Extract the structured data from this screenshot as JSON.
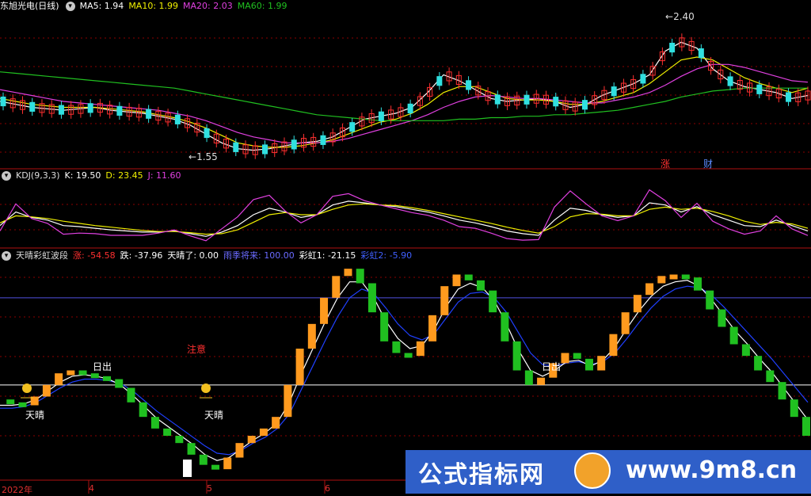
{
  "panels": {
    "price": {
      "stock_name": "东旭光电(日线)",
      "ma5_label": "MA5: 1.94",
      "ma10_label": "MA10: 1.99",
      "ma20_label": "MA20: 2.03",
      "ma60_label": "MA60: 1.99",
      "high_label": "2.40",
      "low_label": "1.55",
      "tag_zhang": "涨",
      "tag_cai": "财"
    },
    "kdj": {
      "title": "KDJ(9,3,3)",
      "k_label": "K: 19.50",
      "d_label": "D: 23.45",
      "j_label": "J: 11.60"
    },
    "rainbow": {
      "title": "天晴彩虹波段",
      "zhang_label": "涨: -54.58",
      "die_label": "跌: -37.96",
      "tianqing_label": "天晴了: 0.00",
      "yuji_label": "雨季将来: 100.00",
      "caihong1_label": "彩虹1: -21.15",
      "caihong2_label": "彩虹2: -5.90",
      "annotations": {
        "richu": "日出",
        "zhuyi": "注意",
        "tianqing": "天晴"
      }
    }
  },
  "xaxis": {
    "labels": [
      "2022年",
      "4",
      "5",
      "6"
    ]
  },
  "watermark": {
    "cn": "公式指标网",
    "url": "www.9m8.cn"
  },
  "colors": {
    "bg": "#000000",
    "grid": "#8b0000",
    "ma5": "#ffffff",
    "ma10": "#f0f000",
    "ma20": "#e040e0",
    "ma60": "#20c020",
    "up": "#ff3030",
    "down": "#30e0e0",
    "bar_up": "#ff9a1e",
    "bar_down": "#20c020",
    "k": "#ffffff",
    "d": "#f0f000",
    "j": "#e040e0",
    "rainbow1": "#ffffff",
    "rainbow2": "#2040ff"
  },
  "chart_data": [
    {
      "type": "candlestick",
      "title": "东旭光电(日线)",
      "series": [
        {
          "name": "MA5",
          "values": [
            1.9,
            1.88,
            1.86,
            1.85,
            1.84,
            1.85,
            1.86,
            1.84,
            1.83,
            1.82,
            1.8,
            1.78,
            1.74,
            1.68,
            1.62,
            1.58,
            1.57,
            1.58,
            1.6,
            1.62,
            1.63,
            1.66,
            1.72,
            1.78,
            1.8,
            1.82,
            1.86,
            1.96,
            2.08,
            2.04,
            1.98,
            1.92,
            1.9,
            1.91,
            1.92,
            1.9,
            1.86,
            1.88,
            1.94,
            1.98,
            2.02,
            2.08,
            2.24,
            2.3,
            2.26,
            2.12,
            2.04,
            2.0,
            1.98,
            1.96,
            1.92,
            1.94
          ]
        },
        {
          "name": "MA10",
          "values": [
            1.92,
            1.9,
            1.88,
            1.87,
            1.86,
            1.86,
            1.86,
            1.85,
            1.84,
            1.83,
            1.81,
            1.79,
            1.76,
            1.72,
            1.67,
            1.62,
            1.6,
            1.59,
            1.59,
            1.6,
            1.62,
            1.64,
            1.68,
            1.72,
            1.76,
            1.78,
            1.82,
            1.88,
            1.96,
            2.0,
            2.0,
            1.96,
            1.92,
            1.91,
            1.91,
            1.9,
            1.88,
            1.88,
            1.9,
            1.93,
            1.96,
            2.02,
            2.1,
            2.18,
            2.2,
            2.18,
            2.12,
            2.06,
            2.02,
            1.99,
            1.96,
            1.99
          ]
        },
        {
          "name": "MA20",
          "values": [
            1.98,
            1.96,
            1.94,
            1.92,
            1.9,
            1.89,
            1.88,
            1.87,
            1.86,
            1.85,
            1.84,
            1.82,
            1.8,
            1.77,
            1.73,
            1.69,
            1.66,
            1.64,
            1.62,
            1.62,
            1.62,
            1.63,
            1.65,
            1.68,
            1.71,
            1.74,
            1.77,
            1.81,
            1.86,
            1.9,
            1.93,
            1.94,
            1.93,
            1.92,
            1.92,
            1.91,
            1.9,
            1.89,
            1.89,
            1.91,
            1.93,
            1.96,
            2.01,
            2.07,
            2.12,
            2.15,
            2.15,
            2.13,
            2.1,
            2.07,
            2.04,
            2.03
          ]
        },
        {
          "name": "MA60",
          "values": [
            2.1,
            2.09,
            2.08,
            2.07,
            2.06,
            2.05,
            2.04,
            2.03,
            2.02,
            2.01,
            2.0,
            1.99,
            1.97,
            1.95,
            1.93,
            1.91,
            1.89,
            1.87,
            1.85,
            1.83,
            1.81,
            1.8,
            1.79,
            1.78,
            1.77,
            1.77,
            1.77,
            1.77,
            1.77,
            1.78,
            1.78,
            1.79,
            1.79,
            1.8,
            1.8,
            1.81,
            1.81,
            1.82,
            1.83,
            1.84,
            1.86,
            1.88,
            1.9,
            1.93,
            1.95,
            1.97,
            1.98,
            1.99,
            1.99,
            1.99,
            1.99,
            1.99
          ]
        }
      ],
      "extremes": {
        "high": 2.4,
        "low": 1.55
      },
      "ylim": [
        1.45,
        2.5
      ],
      "legend": "top-left"
    },
    {
      "type": "line",
      "title": "KDJ(9,3,3)",
      "series": [
        {
          "name": "K",
          "values": [
            30,
            55,
            45,
            40,
            30,
            28,
            25,
            22,
            20,
            18,
            18,
            20,
            15,
            10,
            18,
            30,
            50,
            62,
            55,
            45,
            50,
            68,
            75,
            72,
            68,
            65,
            60,
            55,
            48,
            40,
            35,
            28,
            20,
            15,
            12,
            40,
            62,
            58,
            50,
            45,
            48,
            72,
            68,
            55,
            65,
            50,
            40,
            30,
            28,
            40,
            30,
            20
          ]
        },
        {
          "name": "D",
          "values": [
            35,
            48,
            46,
            43,
            38,
            34,
            30,
            27,
            24,
            21,
            19,
            19,
            17,
            14,
            15,
            22,
            36,
            50,
            54,
            50,
            50,
            60,
            68,
            70,
            68,
            67,
            63,
            58,
            52,
            46,
            40,
            34,
            27,
            21,
            16,
            28,
            46,
            52,
            51,
            48,
            48,
            60,
            64,
            60,
            62,
            56,
            48,
            38,
            32,
            36,
            33,
            25
          ]
        },
        {
          "name": "J",
          "values": [
            20,
            70,
            43,
            34,
            14,
            16,
            15,
            12,
            12,
            12,
            16,
            22,
            11,
            2,
            24,
            46,
            78,
            86,
            57,
            35,
            50,
            84,
            89,
            76,
            68,
            61,
            54,
            49,
            40,
            28,
            25,
            16,
            6,
            3,
            4,
            64,
            94,
            70,
            48,
            39,
            48,
            96,
            76,
            45,
            71,
            38,
            24,
            14,
            20,
            48,
            24,
            11.6
          ]
        }
      ],
      "ylim": [
        -10,
        110
      ],
      "legend": "top-left"
    },
    {
      "type": "bar",
      "title": "天晴彩虹波段",
      "series": [
        {
          "name": "波段",
          "values": [
            10,
            8,
            6,
            12,
            20,
            28,
            30,
            28,
            26,
            24,
            18,
            8,
            -2,
            -10,
            -15,
            -20,
            -28,
            -35,
            -38,
            -30,
            -20,
            -15,
            -10,
            -2,
            20,
            45,
            62,
            80,
            95,
            100,
            90,
            70,
            50,
            42,
            40,
            50,
            68,
            88,
            96,
            92,
            85,
            70,
            50,
            30,
            20,
            25,
            35,
            42,
            38,
            30,
            40,
            55,
            70,
            82,
            90,
            95,
            96,
            94,
            85,
            72,
            60,
            48,
            40,
            30,
            22,
            10,
            -2,
            -15
          ]
        },
        {
          "name": "彩虹1",
          "values": [
            6,
            6,
            7,
            10,
            16,
            22,
            26,
            27,
            26,
            24,
            20,
            13,
            5,
            -3,
            -9,
            -15,
            -21,
            -28,
            -32,
            -30,
            -24,
            -18,
            -13,
            -6,
            8,
            28,
            46,
            64,
            80,
            91,
            91,
            80,
            64,
            52,
            45,
            47,
            58,
            74,
            86,
            90,
            87,
            78,
            62,
            44,
            30,
            26,
            30,
            36,
            37,
            33,
            37,
            46,
            59,
            71,
            81,
            88,
            91,
            92,
            88,
            79,
            68,
            57,
            48,
            38,
            29,
            18,
            7,
            -4
          ]
        },
        {
          "name": "彩虹2",
          "values": [
            4,
            4,
            5,
            8,
            13,
            18,
            22,
            24,
            24,
            23,
            21,
            16,
            9,
            2,
            -4,
            -10,
            -16,
            -22,
            -27,
            -28,
            -25,
            -20,
            -16,
            -10,
            0,
            17,
            34,
            51,
            67,
            80,
            86,
            83,
            73,
            62,
            54,
            51,
            55,
            66,
            77,
            83,
            84,
            80,
            70,
            56,
            42,
            34,
            33,
            35,
            36,
            34,
            36,
            42,
            52,
            63,
            73,
            81,
            86,
            88,
            87,
            82,
            74,
            65,
            56,
            47,
            38,
            28,
            18,
            8
          ]
        }
      ],
      "thresholds": {
        "upper": 80,
        "lower": 20
      },
      "ylim": [
        -45,
        105
      ],
      "legend": "top-left"
    }
  ]
}
